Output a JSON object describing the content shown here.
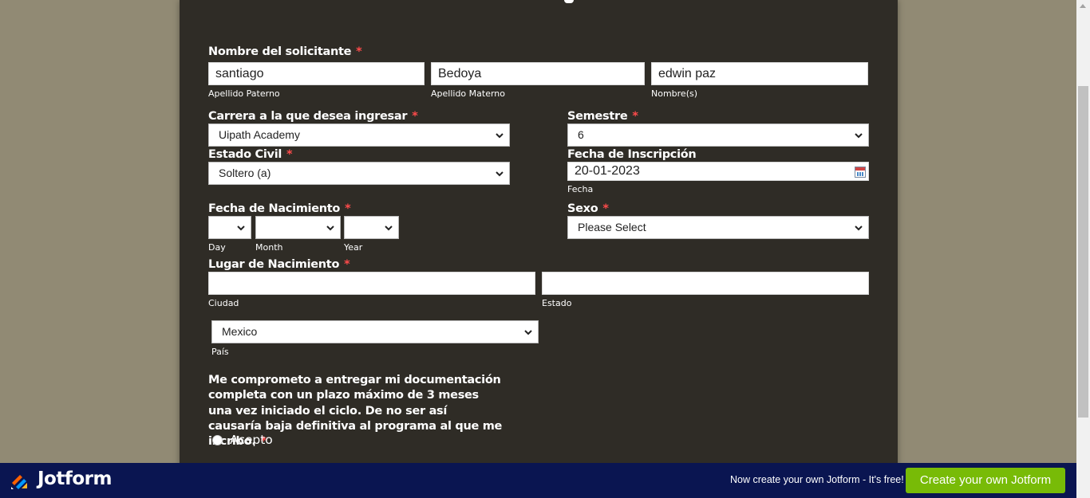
{
  "form": {
    "applicant_name": {
      "label": "Nombre del solicitante",
      "required": "*",
      "apellido_paterno": {
        "value": "santiago",
        "sublabel": "Apellido Paterno"
      },
      "apellido_materno": {
        "value": "Bedoya",
        "sublabel": "Apellido Materno"
      },
      "nombres": {
        "value": "edwin paz",
        "sublabel": "Nombre(s)"
      }
    },
    "carrera": {
      "label": "Carrera a la que desea ingresar",
      "required": "*",
      "value": "Uipath Academy"
    },
    "semestre": {
      "label": "Semestre",
      "required": "*",
      "value": "6"
    },
    "estado_civil": {
      "label": "Estado Civil",
      "required": "*",
      "value": "Soltero (a)"
    },
    "fecha_inscripcion": {
      "label": "Fecha de Inscripción",
      "value": "20-01-2023",
      "sublabel": "Fecha",
      "icon": "calendar-icon"
    },
    "fecha_nacimiento": {
      "label": "Fecha de Nacimiento",
      "required": "*",
      "day": {
        "value": "",
        "sublabel": "Day"
      },
      "month": {
        "value": "",
        "sublabel": "Month"
      },
      "year": {
        "value": "",
        "sublabel": "Year"
      }
    },
    "sexo": {
      "label": "Sexo",
      "required": "*",
      "value": "Please Select"
    },
    "lugar_nacimiento": {
      "label": "Lugar de Nacimiento",
      "required": "*",
      "ciudad": {
        "value": "",
        "sublabel": "Ciudad"
      },
      "estado": {
        "value": "",
        "sublabel": "Estado"
      },
      "pais": {
        "value": "Mexico",
        "sublabel": "País"
      }
    },
    "consent": {
      "text": "Me comprometo a entregar mi documentación completa con un plazo máximo de 3 meses una vez iniciado el ciclo. De no ser así causaría baja definitiva al programa al que me incribo.",
      "required": "*",
      "option": "Acepto"
    }
  },
  "footer": {
    "brand": "Jotform",
    "promo": "Now create your own Jotform - It's free!",
    "cta": "Create your own Jotform"
  },
  "colors": {
    "page_bg": "#918a74",
    "card_bg": "#2f2c26",
    "required": "#ff4b4b",
    "footer_bg": "#0a1551",
    "cta_bg": "#78bb07"
  }
}
